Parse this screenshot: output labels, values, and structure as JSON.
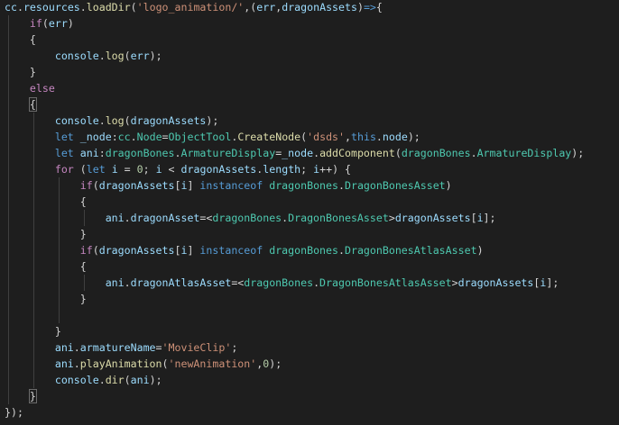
{
  "editor": {
    "background": "#1e1e1e",
    "theme_colors": {
      "plain": "#d4d4d4",
      "variable": "#9cdcfe",
      "function": "#dcdcaa",
      "string": "#ce9178",
      "control_keyword": "#c586c0",
      "keyword": "#569cd6",
      "type": "#4ec9b0",
      "number": "#b5cea8"
    },
    "lines": [
      [
        {
          "t": "var",
          "v": "cc"
        },
        {
          "t": "punc",
          "v": "."
        },
        {
          "t": "var",
          "v": "resources"
        },
        {
          "t": "punc",
          "v": "."
        },
        {
          "t": "fn",
          "v": "loadDir"
        },
        {
          "t": "punc",
          "v": "("
        },
        {
          "t": "str",
          "v": "'logo_animation/'"
        },
        {
          "t": "punc",
          "v": ",("
        },
        {
          "t": "var",
          "v": "err"
        },
        {
          "t": "punc",
          "v": ","
        },
        {
          "t": "var",
          "v": "dragonAssets"
        },
        {
          "t": "punc",
          "v": ")"
        },
        {
          "t": "key",
          "v": "=>"
        },
        {
          "t": "punc",
          "v": "{"
        }
      ],
      [
        {
          "t": "plain",
          "v": "    "
        },
        {
          "t": "kw",
          "v": "if"
        },
        {
          "t": "punc",
          "v": "("
        },
        {
          "t": "var",
          "v": "err"
        },
        {
          "t": "punc",
          "v": ")"
        }
      ],
      [
        {
          "t": "plain",
          "v": "    "
        },
        {
          "t": "punc",
          "v": "{"
        }
      ],
      [
        {
          "t": "plain",
          "v": "        "
        },
        {
          "t": "var",
          "v": "console"
        },
        {
          "t": "punc",
          "v": "."
        },
        {
          "t": "fn",
          "v": "log"
        },
        {
          "t": "punc",
          "v": "("
        },
        {
          "t": "var",
          "v": "err"
        },
        {
          "t": "punc",
          "v": ");"
        }
      ],
      [
        {
          "t": "plain",
          "v": "    "
        },
        {
          "t": "punc",
          "v": "}"
        }
      ],
      [
        {
          "t": "plain",
          "v": "    "
        },
        {
          "t": "kw",
          "v": "else"
        }
      ],
      [
        {
          "t": "plain",
          "v": "    "
        },
        {
          "t": "punc",
          "v": "{",
          "box": true
        }
      ],
      [
        {
          "t": "plain",
          "v": "        "
        },
        {
          "t": "var",
          "v": "console"
        },
        {
          "t": "punc",
          "v": "."
        },
        {
          "t": "fn",
          "v": "log"
        },
        {
          "t": "punc",
          "v": "("
        },
        {
          "t": "var",
          "v": "dragonAssets"
        },
        {
          "t": "punc",
          "v": ");"
        }
      ],
      [
        {
          "t": "plain",
          "v": "        "
        },
        {
          "t": "key",
          "v": "let"
        },
        {
          "t": "plain",
          "v": " "
        },
        {
          "t": "var",
          "v": "_node"
        },
        {
          "t": "punc",
          "v": ":"
        },
        {
          "t": "type",
          "v": "cc"
        },
        {
          "t": "punc",
          "v": "."
        },
        {
          "t": "type",
          "v": "Node"
        },
        {
          "t": "punc",
          "v": "="
        },
        {
          "t": "type",
          "v": "ObjectTool"
        },
        {
          "t": "punc",
          "v": "."
        },
        {
          "t": "fn",
          "v": "CreateNode"
        },
        {
          "t": "punc",
          "v": "("
        },
        {
          "t": "str",
          "v": "'dsds'"
        },
        {
          "t": "punc",
          "v": ","
        },
        {
          "t": "key",
          "v": "this"
        },
        {
          "t": "punc",
          "v": "."
        },
        {
          "t": "var",
          "v": "node"
        },
        {
          "t": "punc",
          "v": ");"
        }
      ],
      [
        {
          "t": "plain",
          "v": "        "
        },
        {
          "t": "key",
          "v": "let"
        },
        {
          "t": "plain",
          "v": " "
        },
        {
          "t": "var",
          "v": "ani"
        },
        {
          "t": "punc",
          "v": ":"
        },
        {
          "t": "type",
          "v": "dragonBones"
        },
        {
          "t": "punc",
          "v": "."
        },
        {
          "t": "type",
          "v": "ArmatureDisplay"
        },
        {
          "t": "punc",
          "v": "="
        },
        {
          "t": "var",
          "v": "_node"
        },
        {
          "t": "punc",
          "v": "."
        },
        {
          "t": "fn",
          "v": "addComponent"
        },
        {
          "t": "punc",
          "v": "("
        },
        {
          "t": "type",
          "v": "dragonBones"
        },
        {
          "t": "punc",
          "v": "."
        },
        {
          "t": "type",
          "v": "ArmatureDisplay"
        },
        {
          "t": "punc",
          "v": ");"
        }
      ],
      [
        {
          "t": "plain",
          "v": "        "
        },
        {
          "t": "kw",
          "v": "for"
        },
        {
          "t": "plain",
          "v": " ("
        },
        {
          "t": "key",
          "v": "let"
        },
        {
          "t": "plain",
          "v": " "
        },
        {
          "t": "var",
          "v": "i"
        },
        {
          "t": "plain",
          "v": " = "
        },
        {
          "t": "num",
          "v": "0"
        },
        {
          "t": "plain",
          "v": "; "
        },
        {
          "t": "var",
          "v": "i"
        },
        {
          "t": "plain",
          "v": " < "
        },
        {
          "t": "var",
          "v": "dragonAssets"
        },
        {
          "t": "punc",
          "v": "."
        },
        {
          "t": "var",
          "v": "length"
        },
        {
          "t": "plain",
          "v": "; "
        },
        {
          "t": "var",
          "v": "i"
        },
        {
          "t": "plain",
          "v": "++) {"
        }
      ],
      [
        {
          "t": "plain",
          "v": "            "
        },
        {
          "t": "kw",
          "v": "if"
        },
        {
          "t": "punc",
          "v": "("
        },
        {
          "t": "var",
          "v": "dragonAssets"
        },
        {
          "t": "punc",
          "v": "["
        },
        {
          "t": "var",
          "v": "i"
        },
        {
          "t": "punc",
          "v": "]"
        },
        {
          "t": "plain",
          "v": " "
        },
        {
          "t": "key",
          "v": "instanceof"
        },
        {
          "t": "plain",
          "v": " "
        },
        {
          "t": "type",
          "v": "dragonBones"
        },
        {
          "t": "punc",
          "v": "."
        },
        {
          "t": "type",
          "v": "DragonBonesAsset"
        },
        {
          "t": "punc",
          "v": ")"
        }
      ],
      [
        {
          "t": "plain",
          "v": "            "
        },
        {
          "t": "punc",
          "v": "{"
        }
      ],
      [
        {
          "t": "plain",
          "v": "                "
        },
        {
          "t": "var",
          "v": "ani"
        },
        {
          "t": "punc",
          "v": "."
        },
        {
          "t": "var",
          "v": "dragonAsset"
        },
        {
          "t": "punc",
          "v": "=<"
        },
        {
          "t": "type",
          "v": "dragonBones"
        },
        {
          "t": "punc",
          "v": "."
        },
        {
          "t": "type",
          "v": "DragonBonesAsset"
        },
        {
          "t": "punc",
          "v": ">"
        },
        {
          "t": "var",
          "v": "dragonAssets"
        },
        {
          "t": "punc",
          "v": "["
        },
        {
          "t": "var",
          "v": "i"
        },
        {
          "t": "punc",
          "v": "];"
        }
      ],
      [
        {
          "t": "plain",
          "v": "            "
        },
        {
          "t": "punc",
          "v": "}"
        }
      ],
      [
        {
          "t": "plain",
          "v": "            "
        },
        {
          "t": "kw",
          "v": "if"
        },
        {
          "t": "punc",
          "v": "("
        },
        {
          "t": "var",
          "v": "dragonAssets"
        },
        {
          "t": "punc",
          "v": "["
        },
        {
          "t": "var",
          "v": "i"
        },
        {
          "t": "punc",
          "v": "]"
        },
        {
          "t": "plain",
          "v": " "
        },
        {
          "t": "key",
          "v": "instanceof"
        },
        {
          "t": "plain",
          "v": " "
        },
        {
          "t": "type",
          "v": "dragonBones"
        },
        {
          "t": "punc",
          "v": "."
        },
        {
          "t": "type",
          "v": "DragonBonesAtlasAsset"
        },
        {
          "t": "punc",
          "v": ")"
        }
      ],
      [
        {
          "t": "plain",
          "v": "            "
        },
        {
          "t": "punc",
          "v": "{"
        }
      ],
      [
        {
          "t": "plain",
          "v": "                "
        },
        {
          "t": "var",
          "v": "ani"
        },
        {
          "t": "punc",
          "v": "."
        },
        {
          "t": "var",
          "v": "dragonAtlasAsset"
        },
        {
          "t": "punc",
          "v": "=<"
        },
        {
          "t": "type",
          "v": "dragonBones"
        },
        {
          "t": "punc",
          "v": "."
        },
        {
          "t": "type",
          "v": "DragonBonesAtlasAsset"
        },
        {
          "t": "punc",
          "v": ">"
        },
        {
          "t": "var",
          "v": "dragonAssets"
        },
        {
          "t": "punc",
          "v": "["
        },
        {
          "t": "var",
          "v": "i"
        },
        {
          "t": "punc",
          "v": "];"
        }
      ],
      [
        {
          "t": "plain",
          "v": "            "
        },
        {
          "t": "punc",
          "v": "}"
        }
      ],
      [
        {
          "t": "plain",
          "v": ""
        }
      ],
      [
        {
          "t": "plain",
          "v": "        "
        },
        {
          "t": "punc",
          "v": "}"
        }
      ],
      [
        {
          "t": "plain",
          "v": "        "
        },
        {
          "t": "var",
          "v": "ani"
        },
        {
          "t": "punc",
          "v": "."
        },
        {
          "t": "var",
          "v": "armatureName"
        },
        {
          "t": "punc",
          "v": "="
        },
        {
          "t": "str",
          "v": "'MovieClip'"
        },
        {
          "t": "punc",
          "v": ";"
        }
      ],
      [
        {
          "t": "plain",
          "v": "        "
        },
        {
          "t": "var",
          "v": "ani"
        },
        {
          "t": "punc",
          "v": "."
        },
        {
          "t": "fn",
          "v": "playAnimation"
        },
        {
          "t": "punc",
          "v": "("
        },
        {
          "t": "str",
          "v": "'newAnimation'"
        },
        {
          "t": "punc",
          "v": ","
        },
        {
          "t": "num",
          "v": "0"
        },
        {
          "t": "punc",
          "v": ");"
        }
      ],
      [
        {
          "t": "plain",
          "v": "        "
        },
        {
          "t": "var",
          "v": "console"
        },
        {
          "t": "punc",
          "v": "."
        },
        {
          "t": "fn",
          "v": "dir"
        },
        {
          "t": "punc",
          "v": "("
        },
        {
          "t": "var",
          "v": "ani"
        },
        {
          "t": "punc",
          "v": ");"
        }
      ],
      [
        {
          "t": "plain",
          "v": "    "
        },
        {
          "t": "punc",
          "v": "}",
          "box": true
        }
      ],
      [
        {
          "t": "punc",
          "v": "});"
        }
      ]
    ]
  }
}
